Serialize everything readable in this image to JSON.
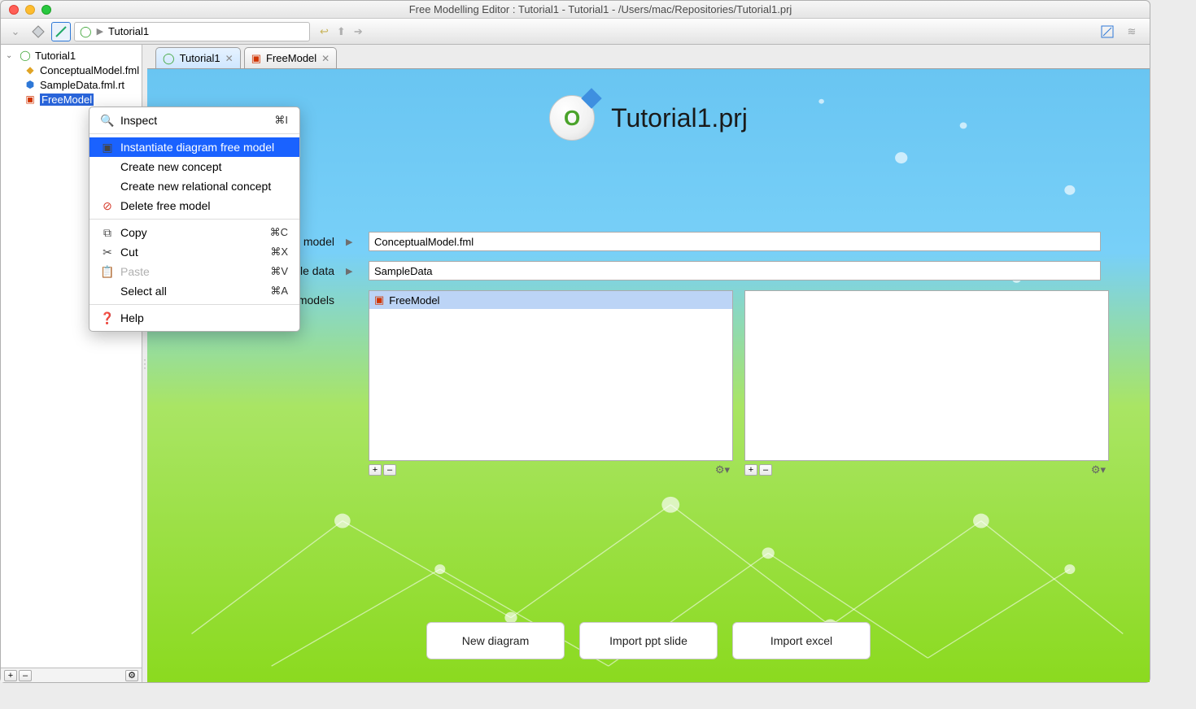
{
  "titlebar": {
    "title": "Free Modelling Editor : Tutorial1 - Tutorial1 - /Users/mac/Repositories/Tutorial1.prj"
  },
  "toolbar": {
    "breadcrumb": "Tutorial1"
  },
  "tree": {
    "root": {
      "label": "Tutorial1"
    },
    "children": [
      {
        "label": "ConceptualModel.fml"
      },
      {
        "label": "SampleData.fml.rt"
      },
      {
        "label": "FreeModel",
        "selected": true
      }
    ]
  },
  "context_menu": {
    "inspect": {
      "label": "Inspect",
      "shortcut": "⌘I"
    },
    "instantiate": {
      "label": "Instantiate diagram free model"
    },
    "create_concept": {
      "label": "Create new concept"
    },
    "create_relational": {
      "label": "Create new relational concept"
    },
    "delete": {
      "label": "Delete free model"
    },
    "copy": {
      "label": "Copy",
      "shortcut": "⌘C"
    },
    "cut": {
      "label": "Cut",
      "shortcut": "⌘X"
    },
    "paste": {
      "label": "Paste",
      "shortcut": "⌘V"
    },
    "select_all": {
      "label": "Select all",
      "shortcut": "⌘A"
    },
    "help": {
      "label": "Help"
    }
  },
  "tabs": [
    {
      "label": "Tutorial1",
      "active": true
    },
    {
      "label": "FreeModel",
      "active": false
    }
  ],
  "page": {
    "project_title": "Tutorial1.prj",
    "labels": {
      "conceptual": "Conceptual model",
      "sample": "Sample data",
      "free_models": "Free models"
    },
    "values": {
      "conceptual": "ConceptualModel.fml",
      "sample": "SampleData"
    },
    "free_models_list": [
      {
        "label": "FreeModel",
        "selected": true
      }
    ],
    "buttons": {
      "new_diagram": "New diagram",
      "import_ppt": "Import ppt slide",
      "import_excel": "Import excel"
    }
  }
}
